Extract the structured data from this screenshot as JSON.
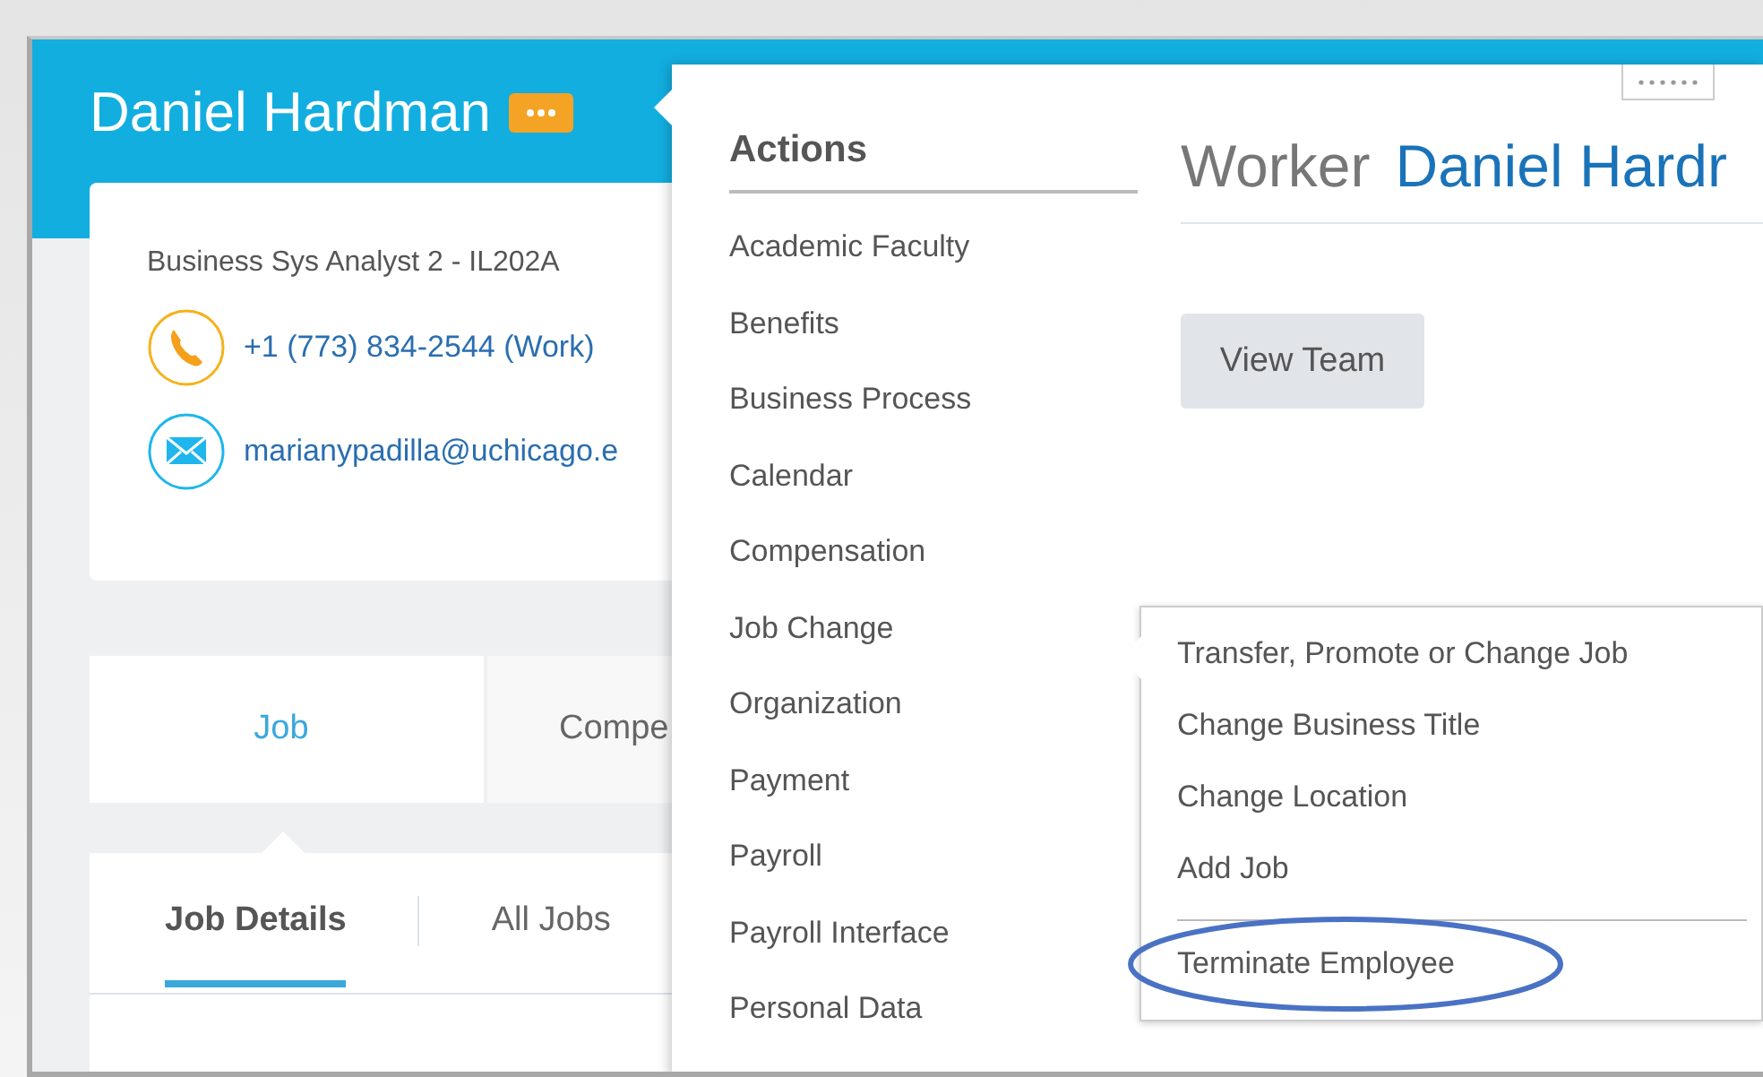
{
  "header": {
    "name": "Daniel Hardman"
  },
  "contact_card": {
    "title": "Business Sys Analyst 2 - IL202A",
    "phone": "+1 (773) 834-2544 (Work)",
    "email": "marianypadilla@uchicago.e"
  },
  "tabs": [
    {
      "label": "Job",
      "selected": true
    },
    {
      "label": "Compe",
      "selected": false
    }
  ],
  "subtabs": [
    {
      "label": "Job Details",
      "selected": true
    },
    {
      "label": "All Jobs",
      "selected": false
    }
  ],
  "actions_menu": {
    "title": "Actions",
    "items": [
      "Academic Faculty",
      "Benefits",
      "Business Process",
      "Calendar",
      "Compensation",
      "Job Change",
      "Organization",
      "Payment",
      "Payroll",
      "Payroll Interface",
      "Personal Data"
    ]
  },
  "worker": {
    "label": "Worker",
    "name": "Daniel Hardr",
    "button": "View Team"
  },
  "submenu": {
    "items": [
      "Transfer, Promote or Change Job",
      "Change Business Title",
      "Change Location",
      "Add Job"
    ],
    "footer_item": {
      "label": "Terminate Employee",
      "circled": true
    }
  }
}
